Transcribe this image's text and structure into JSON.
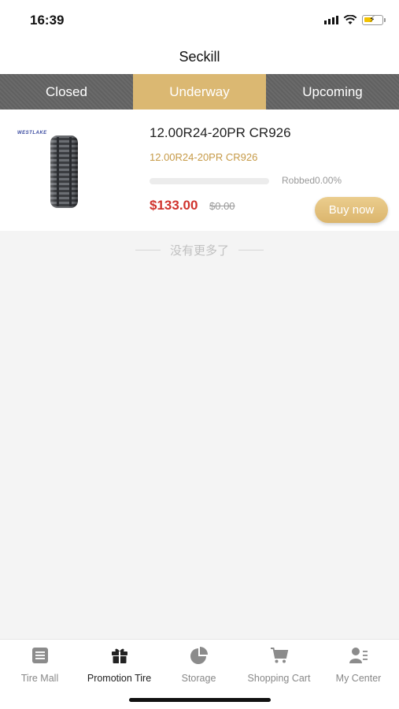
{
  "status_bar": {
    "time": "16:39"
  },
  "header": {
    "title": "Seckill"
  },
  "tabs": [
    {
      "label": "Closed",
      "active": false
    },
    {
      "label": "Underway",
      "active": true
    },
    {
      "label": "Upcoming",
      "active": false
    }
  ],
  "product": {
    "title": "12.00R24-20PR CR926",
    "subtitle": "12.00R24-20PR CR926",
    "brand_logo_text": "WESTLAKE",
    "progress_fraction": 0.0,
    "robbed_text": "Robbed0.00%",
    "price": "$133.00",
    "original_price": "$0.00",
    "buy_label": "Buy now"
  },
  "list_end_text": "没有更多了",
  "bottom_nav": [
    {
      "label": "Tire Mall",
      "icon": "list-icon",
      "active": false
    },
    {
      "label": "Promotion Tire",
      "icon": "gift-icon",
      "active": true
    },
    {
      "label": "Storage",
      "icon": "pie-chart-icon",
      "active": false
    },
    {
      "label": "Shopping Cart",
      "icon": "cart-icon",
      "active": false
    },
    {
      "label": "My Center",
      "icon": "user-icon",
      "active": false
    }
  ],
  "colors": {
    "accent_gold": "#dbb872",
    "price_red": "#d0332d",
    "tab_bg": "#616161"
  }
}
